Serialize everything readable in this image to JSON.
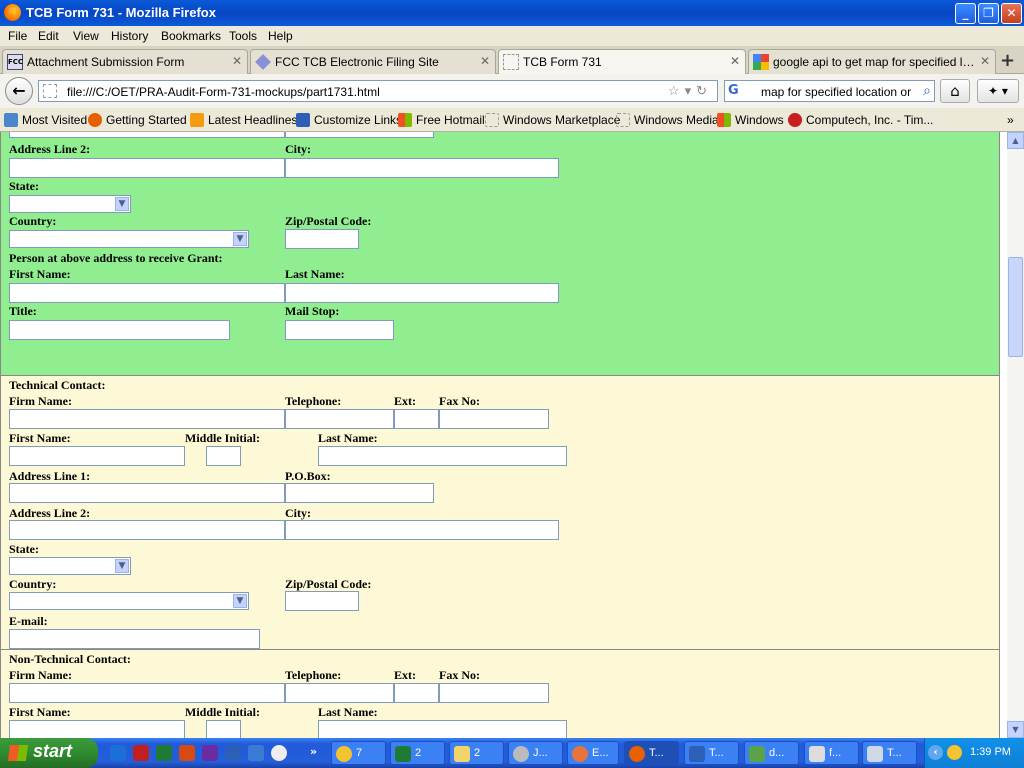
{
  "window": {
    "title": "TCB Form 731 - Mozilla Firefox"
  },
  "menu": [
    "File",
    "Edit",
    "View",
    "History",
    "Bookmarks",
    "Tools",
    "Help"
  ],
  "tabs": [
    {
      "label": "Attachment Submission Form"
    },
    {
      "label": "FCC TCB Electronic Filing Site"
    },
    {
      "label": "TCB Form 731"
    },
    {
      "label": "google api to get map for specified locati..."
    }
  ],
  "nav": {
    "url": "file:///C:/OET/PRA-Audit-Form-731-mockups/part1731.html",
    "search": "map for specified location or cit",
    "search_engine_icon": "G"
  },
  "bookmarks": [
    "Most Visited",
    "Getting Started",
    "Latest Headlines",
    "Customize Links",
    "Free Hotmail",
    "Windows Marketplace",
    "Windows Media",
    "Windows",
    "Computech, Inc. - Tim..."
  ],
  "grantee": {
    "address_line2": "Address Line 2:",
    "city": "City:",
    "state": "State:",
    "country": "Country:",
    "zip": "Zip/Postal Code:",
    "person_heading": "Person at above address to receive Grant:",
    "first_name": "First Name:",
    "last_name": "Last Name:",
    "title": "Title:",
    "mail_stop": "Mail Stop:"
  },
  "technical": {
    "heading": "Technical Contact:",
    "firm_name": "Firm Name:",
    "telephone": "Telephone:",
    "ext": "Ext:",
    "fax": "Fax No:",
    "first_name": "First Name:",
    "middle_initial": "Middle Initial:",
    "last_name": "Last Name:",
    "address_line1": "Address Line 1:",
    "po_box": "P.O.Box:",
    "address_line2": "Address Line 2:",
    "city": "City:",
    "state": "State:",
    "country": "Country:",
    "zip": "Zip/Postal Code:",
    "email": "E-mail:"
  },
  "nontechnical": {
    "heading": "Non-Technical Contact:",
    "firm_name": "Firm Name:",
    "telephone": "Telephone:",
    "ext": "Ext:",
    "fax": "Fax No:",
    "first_name": "First Name:",
    "middle_initial": "Middle Initial:",
    "last_name": "Last Name:"
  },
  "taskbar": {
    "start": "start",
    "tasks": [
      {
        "label": "7"
      },
      {
        "label": "2"
      },
      {
        "label": "2"
      },
      {
        "label": "J..."
      },
      {
        "label": "E..."
      },
      {
        "label": "T..."
      },
      {
        "label": "T..."
      },
      {
        "label": "d..."
      },
      {
        "label": "f..."
      },
      {
        "label": "T..."
      }
    ],
    "clock": "1:39 PM"
  },
  "colors": {
    "grantee_bg": "#90ee90",
    "contact_bg": "#fdf8d6",
    "titlebar": "#0a5ad8"
  }
}
